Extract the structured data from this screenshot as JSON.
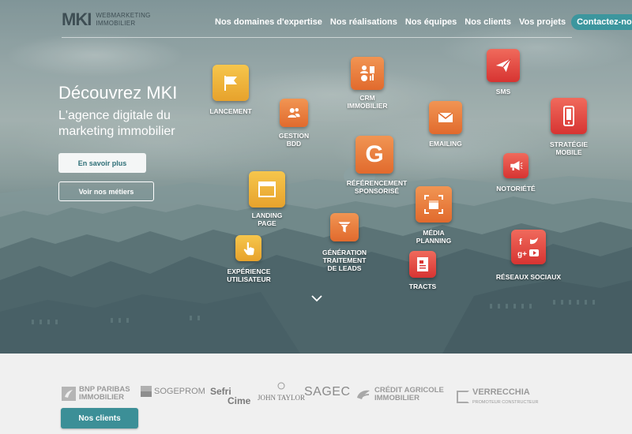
{
  "brand": {
    "mark": "MKI",
    "line1": "WEBMARKETING",
    "line2": "IMMOBILIER"
  },
  "nav": {
    "items": [
      "Nos domaines d'expertise",
      "Nos réalisations",
      "Nos équipes",
      "Nos clients",
      "Vos projets"
    ],
    "contact": "Contactez-nous"
  },
  "hero": {
    "title": "Découvrez MKI",
    "subtitle": "L'agence digitale du marketing immobilier",
    "primary_button": "En savoir plus",
    "secondary_button": "Voir nos métiers"
  },
  "services": {
    "lancement": "LANCEMENT",
    "gestion_bdd_1": "GESTION",
    "gestion_bdd_2": "BDD",
    "crm_1": "CRM",
    "crm_2": "IMMOBILIER",
    "emailing": "EMAILING",
    "sms": "SMS",
    "strategie_1": "STRATÉGIE",
    "strategie_2": "MOBILE",
    "referencement_1": "RÉFÉRENCEMENT",
    "referencement_2": "SPONSORISÉ",
    "notoriete": "NOTORIÉTÉ",
    "landing_1": "LANDING",
    "landing_2": "PAGE",
    "media_1": "MÉDIA",
    "media_2": "PLANNING",
    "generation_1": "GÉNÉRATION",
    "generation_2": "TRAITEMENT",
    "generation_3": "DE LEADS",
    "experience_1": "EXPÉRIENCE",
    "experience_2": "UTILISATEUR",
    "tracts": "TRACTS",
    "reseaux": "RÉSEAUX SOCIAUX"
  },
  "referencement_letter": "G",
  "clients": {
    "bnp_1": "BNP PARIBAS",
    "bnp_2": "IMMOBILIER",
    "sogeprom": "SOGEPROM",
    "sefri_1": "Sefri",
    "sefri_2": "Cime",
    "john_taylor_1": "JOHN TAYLOR",
    "sagec": "SAGEC",
    "ca_1": "CRÉDIT AGRICOLE",
    "ca_2": "IMMOBILIER",
    "verrecchia_1": "VERRECCHIA",
    "verrecchia_2": "PROMOTEUR CONSTRUCTEUR",
    "button": "Nos clients"
  },
  "colors": {
    "accent": "#3c969e",
    "tile_yellow": "#f2b53f",
    "tile_orange": "#e9793a",
    "tile_red": "#e04740"
  },
  "icons": [
    "flag-icon",
    "contacts-icon",
    "crm-icon",
    "envelope-icon",
    "paper-plane-icon",
    "smartphone-icon",
    "megaphone-icon",
    "browser-window-icon",
    "calendar-target-icon",
    "funnel-icon",
    "pointer-hand-icon",
    "document-icon",
    "social-icons",
    "chevron-down-icon"
  ]
}
